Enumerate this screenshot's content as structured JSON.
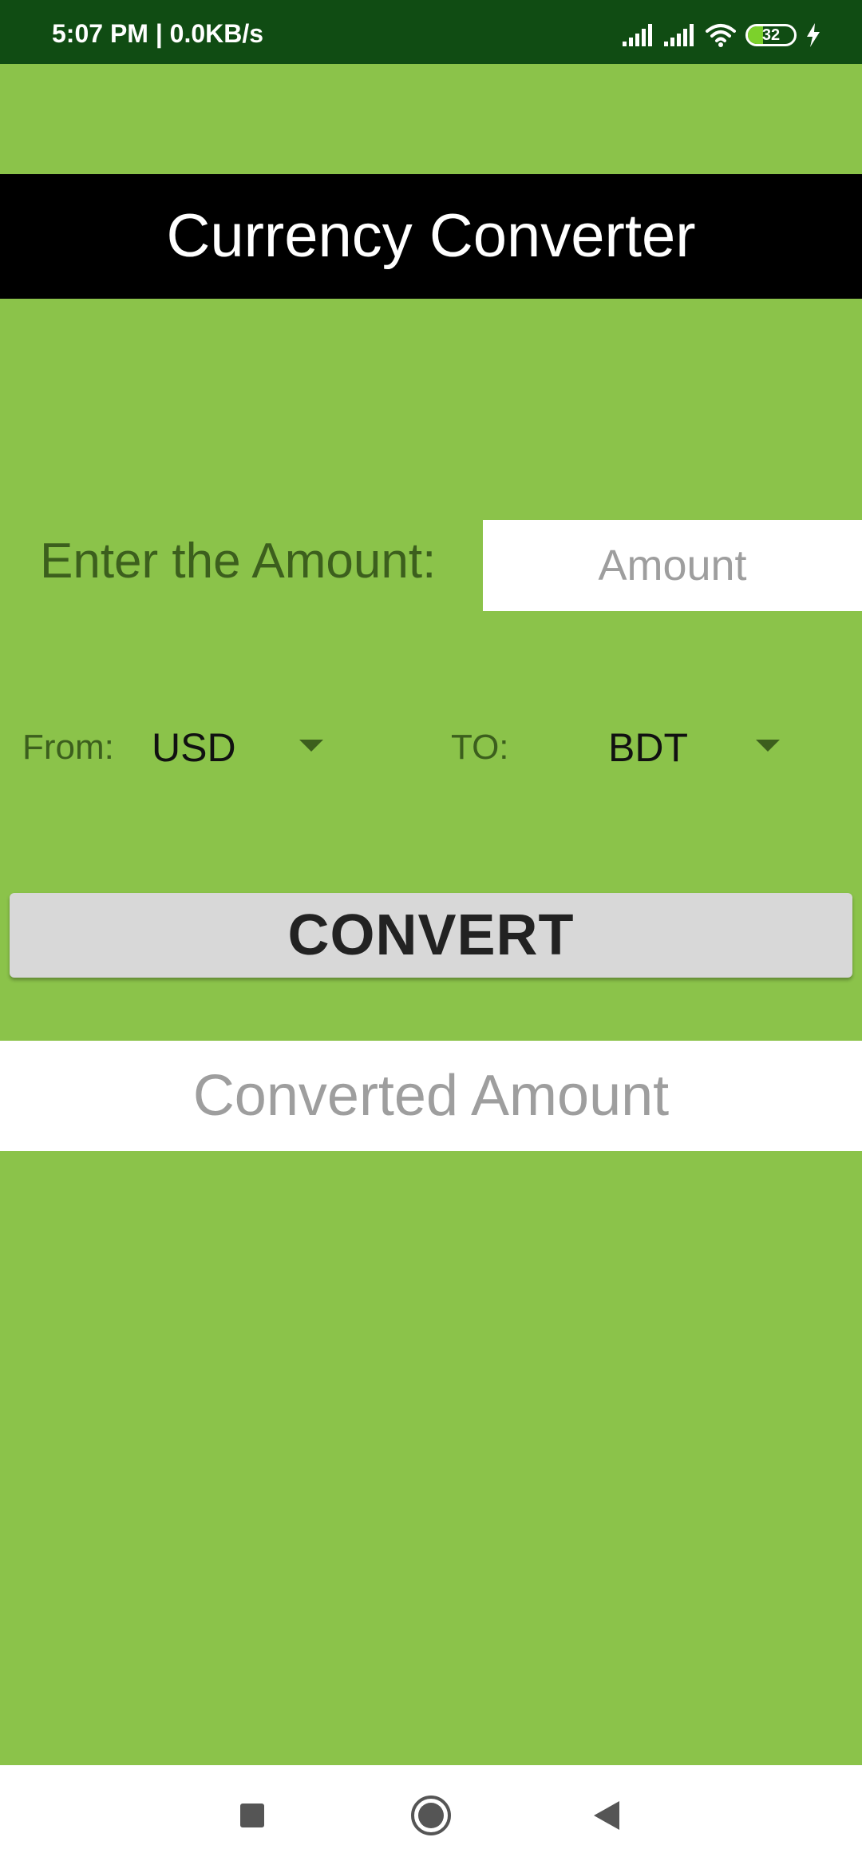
{
  "status_bar": {
    "time_text": "5:07 PM | 0.0KB/s",
    "battery_level": "32",
    "battery_fraction": 0.32,
    "icons": [
      "signal-icon",
      "signal-icon",
      "wifi-icon",
      "battery-icon",
      "charging-icon"
    ]
  },
  "app": {
    "title": "Currency Converter"
  },
  "amount": {
    "label": "Enter the Amount:",
    "placeholder": "Amount",
    "value": ""
  },
  "currency": {
    "from_label": "From:",
    "from_value": "USD",
    "to_label": "TO:",
    "to_value": "BDT"
  },
  "convert_button": {
    "label": "CONVERT"
  },
  "result": {
    "placeholder": "Converted Amount"
  },
  "nav_bar": {
    "icons": [
      "recents-icon",
      "home-icon",
      "back-icon"
    ]
  },
  "colors": {
    "background": "#8bc34a",
    "status_bar": "#104c13",
    "title_bar": "#000000",
    "label_text": "#3c5f1d",
    "button": "#d8d8d8"
  }
}
